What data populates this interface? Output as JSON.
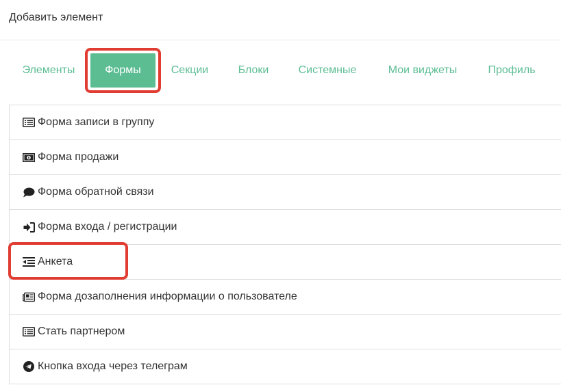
{
  "header": {
    "title": "Добавить элемент"
  },
  "tabs": [
    {
      "label": "Элементы",
      "active": false
    },
    {
      "label": "Формы",
      "active": true
    },
    {
      "label": "Секции",
      "active": false
    },
    {
      "label": "Блоки",
      "active": false
    },
    {
      "label": "Системные",
      "active": false
    },
    {
      "label": "Мои виджеты",
      "active": false
    },
    {
      "label": "Профиль",
      "active": false
    }
  ],
  "items": [
    {
      "label": "Форма записи в группу",
      "icon": "list-alt-icon"
    },
    {
      "label": "Форма продажи",
      "icon": "money-icon"
    },
    {
      "label": "Форма обратной связи",
      "icon": "comment-icon"
    },
    {
      "label": "Форма входа / регистрации",
      "icon": "sign-in-icon"
    },
    {
      "label": "Анкета",
      "icon": "outdent-icon"
    },
    {
      "label": "Форма дозаполнения информации о пользователе",
      "icon": "newspaper-icon"
    },
    {
      "label": "Стать партнером",
      "icon": "list-alt-icon"
    },
    {
      "label": "Кнопка входа через телеграм",
      "icon": "telegram-icon"
    }
  ],
  "colors": {
    "accent": "#5cbd93",
    "highlight": "#e03c31",
    "border": "#dddddd"
  }
}
